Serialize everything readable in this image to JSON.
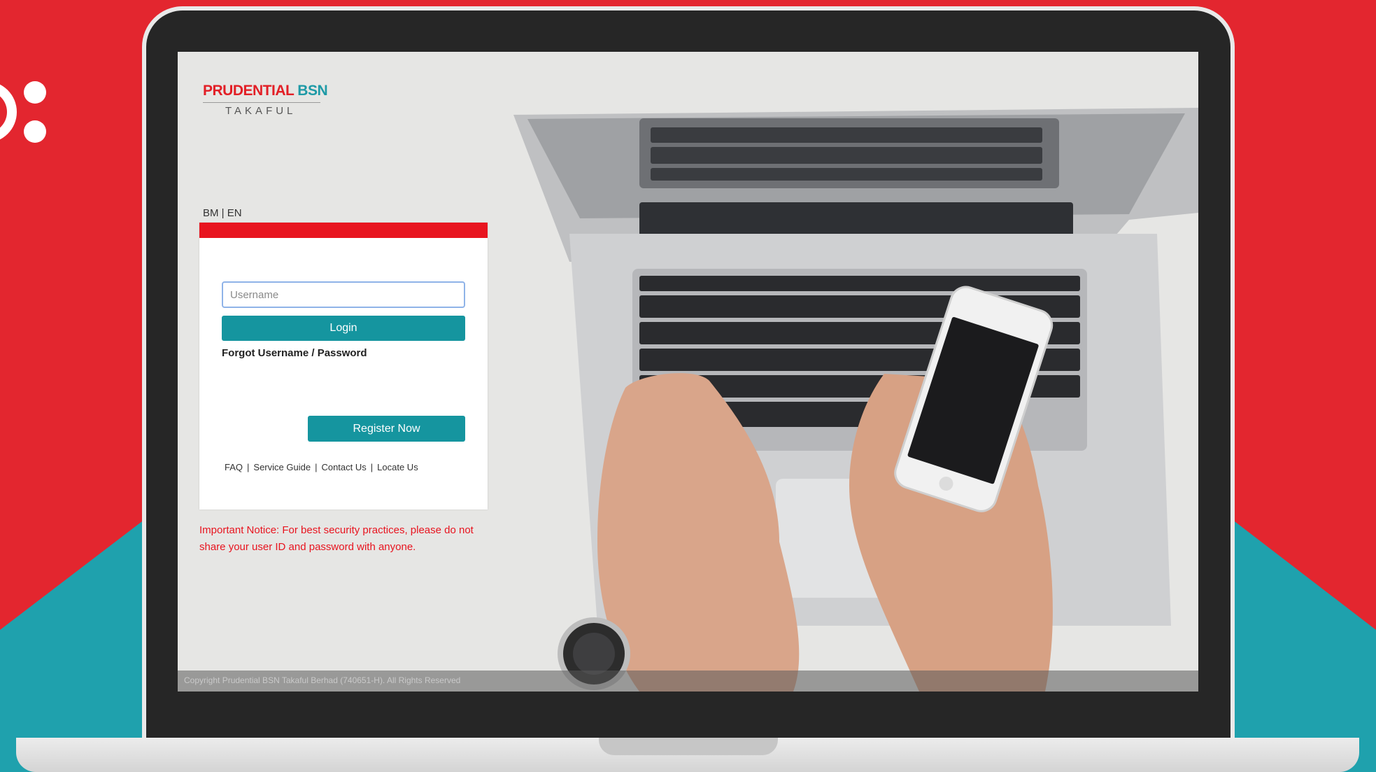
{
  "colors": {
    "background_red": "#e3262f",
    "background_teal": "#1fa1ad",
    "brand_red": "#e21f26",
    "brand_teal": "#1e9aa6",
    "button_teal": "#15959f",
    "notice_red": "#e8141f"
  },
  "logo": {
    "brand_primary": "PRUDENTIAL",
    "brand_secondary": "BSN",
    "subtitle": "TAKAFUL"
  },
  "language": {
    "bm": "BM",
    "separator": "|",
    "en": "EN"
  },
  "login_form": {
    "username_placeholder": "Username",
    "login_label": "Login",
    "forgot_label": "Forgot Username / Password",
    "register_label": "Register Now"
  },
  "footer_links": [
    {
      "label": "FAQ"
    },
    {
      "label": "Service Guide"
    },
    {
      "label": "Contact Us"
    },
    {
      "label": "Locate Us"
    }
  ],
  "link_separator": "|",
  "notice": "Important Notice: For best security practices, please do not share your user ID and password with anyone.",
  "copyright": "Copyright Prudential BSN Takaful Berhad (740651-H). All Rights Reserved",
  "background_photo": "laptop-and-smartphone-photo"
}
